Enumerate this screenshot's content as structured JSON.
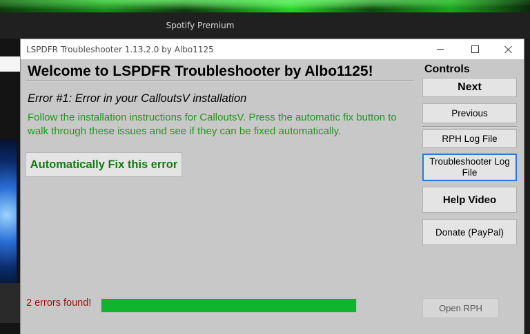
{
  "background": {
    "spotify_title": "Spotify Premium"
  },
  "window": {
    "title": "LSPDFR Troubleshooter 1.13.2.0 by Albo1125"
  },
  "main": {
    "welcome": "Welcome to LSPDFR Troubleshooter by Albo1125!",
    "error_title": "Error #1: Error in your CalloutsV installation",
    "error_description": "Follow the installation instructions for CalloutsV. Press the automatic fix button to walk through these issues and see if they can be fixed automatically.",
    "fix_button": "Automatically Fix this error",
    "errors_found": "2 errors found!",
    "progress_percent": 100
  },
  "controls": {
    "label": "Controls",
    "next": "Next",
    "previous": "Previous",
    "rph_log": "RPH Log File",
    "troubleshooter_log": "Troubleshooter Log File",
    "help_video": "Help Video",
    "donate": "Donate (PayPal)",
    "open_rph": "Open RPH"
  },
  "colors": {
    "accent_green": "#1a9a1a",
    "progress_green": "#0fb52c",
    "error_red": "#9a0f0f",
    "focus_blue": "#2a78d2"
  }
}
